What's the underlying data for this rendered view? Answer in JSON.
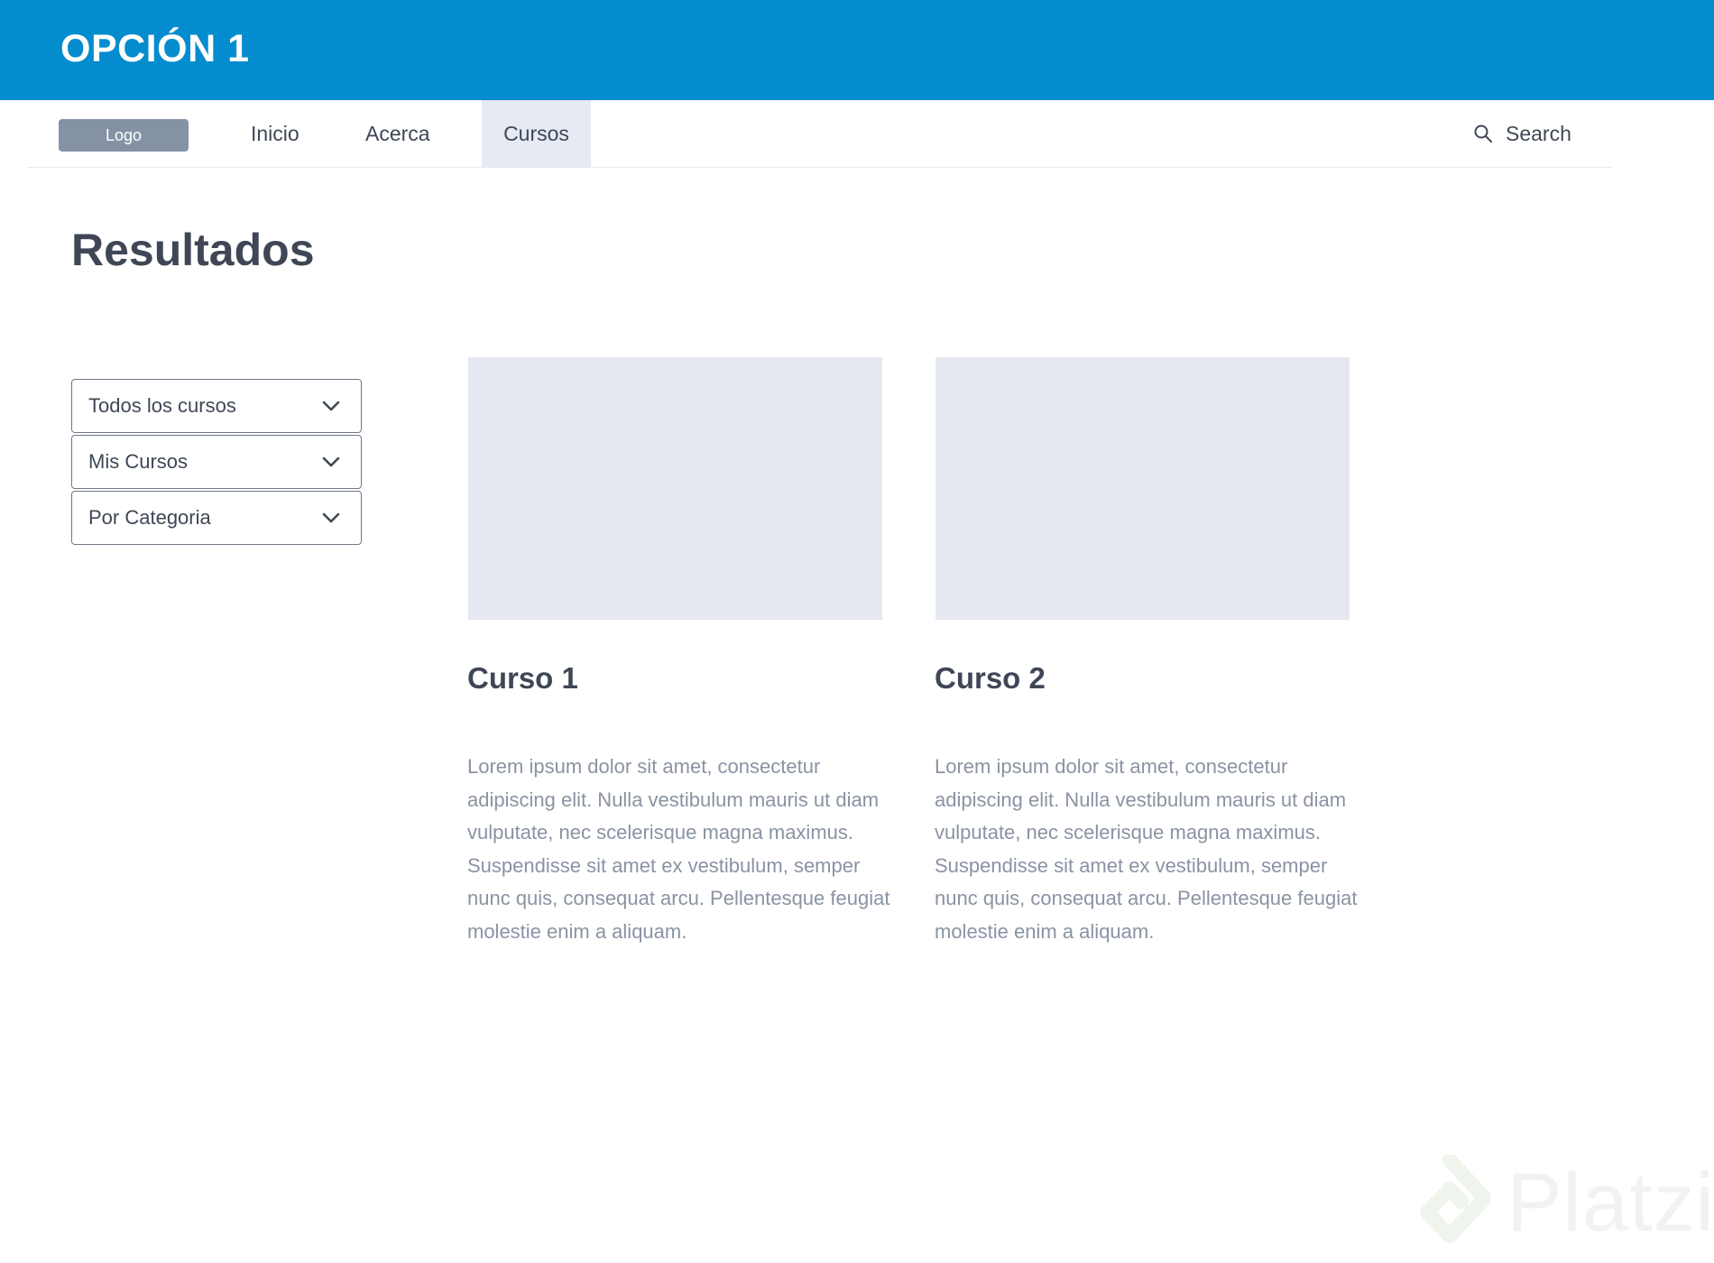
{
  "banner": {
    "title": "OPCIÓN 1"
  },
  "nav": {
    "logo": "Logo",
    "links": [
      "Inicio",
      "Acerca",
      "Cursos"
    ],
    "active": "Cursos",
    "search_label": "Search"
  },
  "main": {
    "title": "Resultados",
    "filters": [
      "Todos los cursos",
      "Mis Cursos",
      "Por Categoria"
    ],
    "courses": [
      {
        "title": "Curso 1",
        "description": "Lorem ipsum dolor sit amet, consectetur adipiscing elit. Nulla vestibulum mauris ut diam vulputate, nec scelerisque magna maximus. Suspendisse sit amet ex vestibulum, semper nunc quis, consequat arcu. Pellentesque feugiat molestie enim a aliquam."
      },
      {
        "title": "Curso 2",
        "description": "Lorem ipsum dolor sit amet, consectetur adipiscing elit. Nulla vestibulum mauris ut diam vulputate, nec scelerisque magna maximus. Suspendisse sit amet ex vestibulum, semper nunc quis, consequat arcu. Pellentesque feugiat molestie enim a aliquam."
      }
    ]
  },
  "watermark": {
    "brand": "Platzi"
  },
  "colors": {
    "banner": "#048ccf",
    "logo_bg": "#8592a6",
    "active_tab_bg": "#e6eaf2",
    "card_image_bg": "#e5e8f0",
    "text_dark": "#3f4756",
    "text_muted": "#8a93a3"
  },
  "icons": {
    "search": "search-icon",
    "chevron": "chevron-down-icon",
    "brand_logo": "platzi-logo"
  }
}
